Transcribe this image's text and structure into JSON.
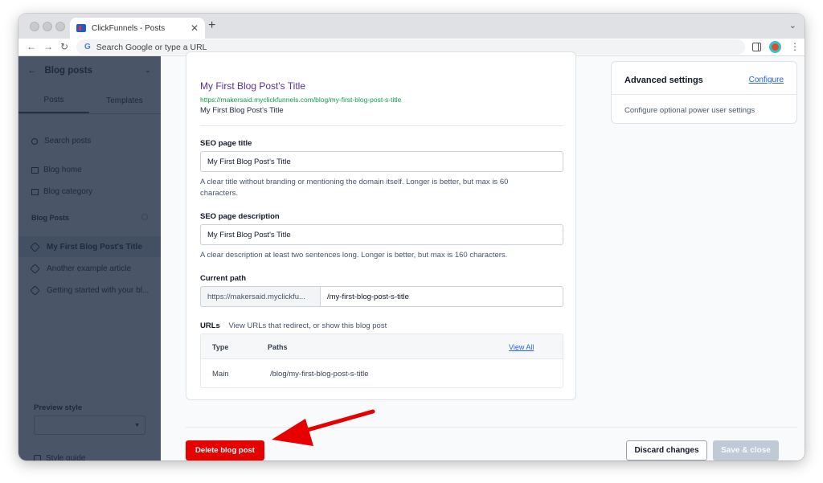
{
  "browser": {
    "tab_title": "ClickFunnels - Posts",
    "omnibox_placeholder": "Search Google or type a URL"
  },
  "sidebar": {
    "header": "Blog posts",
    "tabs": [
      "Posts",
      "Templates"
    ],
    "search_placeholder": "Search posts",
    "nav_items": [
      "Blog home",
      "Blog category"
    ],
    "section_title": "Blog Posts",
    "posts": [
      "My First Blog Post's Title",
      "Another example article",
      "Getting started with your bl..."
    ],
    "preview_style_label": "Preview style",
    "preview_style_value": "",
    "style_guide": "Style guide"
  },
  "preview": {
    "title": "My First Blog Post's Title",
    "url": "https://makersaid.myclickfunnels.com/blog/my-first-blog-post-s-title",
    "description": "My First Blog Post's Title"
  },
  "form": {
    "seo_title_label": "SEO page title",
    "seo_title_value": "My First Blog Post's Title",
    "seo_title_help": "A clear title without branding or mentioning the domain itself. Longer is better, but max is 60 characters.",
    "seo_desc_label": "SEO page description",
    "seo_desc_value": "My First Blog Post's Title",
    "seo_desc_help": "A clear description at least two sentences long. Longer is better, but max is 160 characters.",
    "path_label": "Current path",
    "path_prefix": "https://makersaid.myclickfu...",
    "path_value": "/my-first-blog-post-s-title",
    "urls_label": "URLs",
    "urls_help": "View URLs that redirect, or show this blog post",
    "urls_table": {
      "headers": [
        "Type",
        "Paths"
      ],
      "view_all": "View All",
      "rows": [
        {
          "type": "Main",
          "path": "/blog/my-first-blog-post-s-title"
        }
      ]
    }
  },
  "advanced": {
    "title": "Advanced settings",
    "link": "Configure",
    "description": "Configure optional power user settings"
  },
  "actions": {
    "delete": "Delete blog post",
    "discard": "Discard changes",
    "save": "Save & close"
  },
  "colors": {
    "delete_button": "#e60000",
    "annotation_arrow": "#e60000",
    "link": "#2563eb",
    "sidebar_overlay": "#4a5568"
  }
}
